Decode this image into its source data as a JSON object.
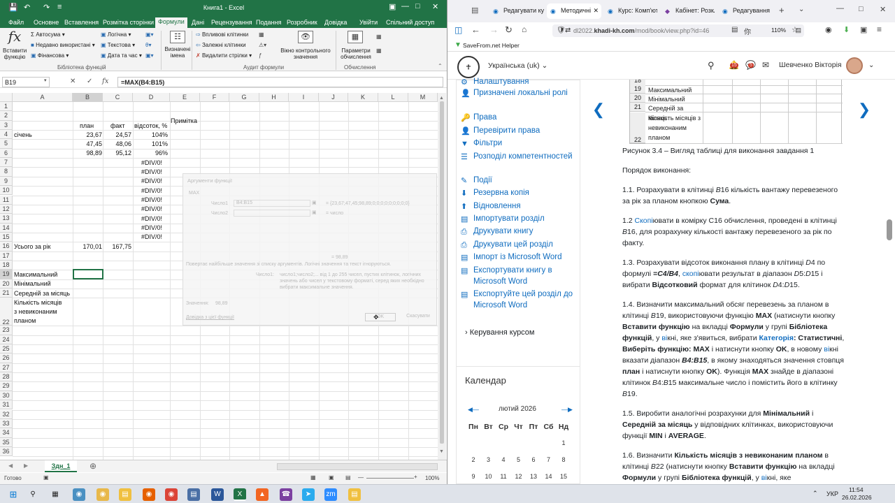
{
  "excel": {
    "title": "Книга1 - Excel",
    "tabs": [
      "Файл",
      "Основне",
      "Вставлення",
      "Розмітка сторінки",
      "Формули",
      "Дані",
      "Рецензування",
      "Подання",
      "Розробник",
      "Довідка",
      "Увійти"
    ],
    "share": "Спільний доступ",
    "ribbon": {
      "insert_fn": "Вставити функцію",
      "autosum": "Автосума",
      "recent": "Недавно використані",
      "financial": "Фінансова",
      "logical": "Логічна",
      "text": "Текстова",
      "datetime": "Дата та час",
      "lib_group": "Бібліотека функцій",
      "defined_names": "Визначені імена",
      "precedents": "Впливові клітинки",
      "dependents": "Залежні клітинки",
      "remove_arrows": "Видалити стрілки",
      "watch": "Вікно контрольного значення",
      "audit_group": "Аудит формули",
      "calc_options": "Параметри обчислення",
      "calc_group": "Обчислення"
    },
    "namebox": "B19",
    "formula": "=MAX(B4:B15)",
    "columns": [
      "A",
      "B",
      "C",
      "D",
      "E",
      "F",
      "G",
      "H",
      "I",
      "J",
      "K",
      "L",
      "M"
    ],
    "rows": [
      "1",
      "2",
      "3",
      "4",
      "5",
      "6",
      "7",
      "8",
      "9",
      "10",
      "11",
      "12",
      "13",
      "14",
      "15",
      "16",
      "17",
      "18",
      "19",
      "20",
      "21",
      "22",
      "23",
      "24",
      "25",
      "26",
      "27",
      "28",
      "29",
      "30",
      "31",
      "32",
      "33",
      "34",
      "35",
      "36"
    ],
    "headers": {
      "plan": "план",
      "fact": "факт",
      "percent": "відсоток, %",
      "note": "Примітка"
    },
    "data_rows": [
      {
        "a": "січень",
        "b": "23,67",
        "c": "24,57",
        "d": "104%"
      },
      {
        "a": "",
        "b": "47,45",
        "c": "48,06",
        "d": "101%"
      },
      {
        "a": "",
        "b": "98,89",
        "c": "95,12",
        "d": "96%"
      }
    ],
    "div_errors": [
      "#DIV/0!",
      "#DIV/0!",
      "#DIV/0!",
      "#DIV/0!",
      "#DIV/0!",
      "#DIV/0!",
      "#DIV/0!",
      "#DIV/0!",
      "#DIV/0!"
    ],
    "total": {
      "label": "Усього за рік",
      "b": "170,01",
      "c": "167,75"
    },
    "labels": {
      "max": "Максимальний",
      "min": "Мінімальний",
      "avg": "Середній за місяць",
      "months1": "Кількість місяців",
      "months2": "з невиконаним",
      "months3": "планом"
    },
    "dialog": {
      "title": "Аргументи функції",
      "fn": "MAX",
      "arg1_label": "Число1",
      "arg1_value": "B4:B15",
      "arg1_result": "= {23,67;47,45;98,89;0;0;0;0;0;0;0;0;0}",
      "arg2_label": "Число2",
      "arg2_result": "= число",
      "result": "= 98,89",
      "desc": "Повертає найбільше значення зі списку аргументів. Логічні значення та текст ігноруються.",
      "arg_help_label": "Число1:",
      "arg_help1": "число1;число2;... від 1 до 255 чисел, пустих клітинок, логічних",
      "arg_help2": "значень або чисел у текстовому форматі, серед яких необхідно",
      "arg_help3": "вибрати максимальне значення.",
      "value_label": "Значення:",
      "value": "98,89",
      "help_link": "Довідка з цієї функції",
      "ok": "OK",
      "cancel": "Скасувати"
    },
    "sheet": "Здн_1",
    "status": "Готово",
    "zoom": "100%"
  },
  "browser": {
    "tabs": [
      "Редагувати ку",
      "Методичні",
      "Курс: Комп'ют",
      "Кабінет: Розкл",
      "Редагування к"
    ],
    "url_domain": "dl2022.",
    "url_host": "khadi-kh.com",
    "url_path": "/mod/book/view.php?id=46",
    "zoom": "110%",
    "bookmark": "SaveFrom.net Helper",
    "lang": "Українська (uk)",
    "notif_count1": "15",
    "notif_count2": "5",
    "user": "Шевченко Вікторія",
    "nav": [
      "Налаштування",
      "Призначені локальні ролі",
      "Права",
      "Перевірити права",
      "Фільтри",
      "Розподіл компетентностей",
      "Події",
      "Резервна копія",
      "Відновлення",
      "Імпортувати розділ",
      "Друкувати книгу",
      "Друкувати цей розділ",
      "Імпорт із Microsoft Word",
      "Експортувати книгу в Microsoft Word",
      "Експортуйте цей розділ до Microsoft Word"
    ],
    "course_admin": "Керування курсом",
    "calendar_title": "Календар",
    "calendar_month": "лютий 2026",
    "weekdays": [
      "Пн",
      "Вт",
      "Ср",
      "Чт",
      "Пт",
      "Сб",
      "Нд"
    ],
    "cal_row1": [
      "",
      "",
      "",
      "",
      "",
      "",
      "1"
    ],
    "cal_row2": [
      "2",
      "3",
      "4",
      "5",
      "6",
      "7",
      "8"
    ],
    "cal_row3": [
      "9",
      "10",
      "11",
      "12",
      "13",
      "14",
      "15"
    ],
    "table_rows": [
      {
        "n": "18",
        "t": ""
      },
      {
        "n": "19",
        "t": "Максимальний"
      },
      {
        "n": "20",
        "t": "Мінімальний"
      },
      {
        "n": "21",
        "t": "Середній за місяць"
      },
      {
        "n": "22",
        "t": "Кількість місяців з невиконаним планом"
      }
    ],
    "caption": "Рисунок 3.4 – Вигляд таблиці для виконання завдання 1",
    "order": "Порядок виконання:"
  },
  "taskbar": {
    "lang": "УКР",
    "time": "11:54",
    "date": "26.02.2026"
  }
}
